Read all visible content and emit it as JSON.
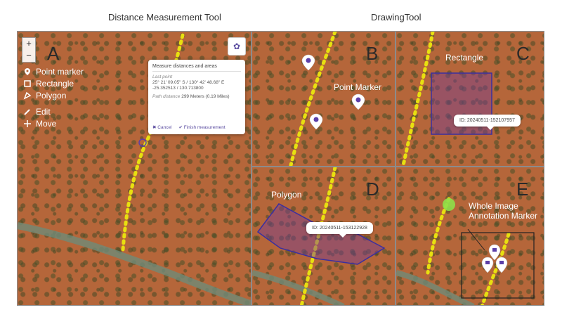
{
  "titles": {
    "left": "Distance Measurement Tool",
    "right": "DrawingTool"
  },
  "panels": {
    "a": {
      "letter": "A"
    },
    "b": {
      "letter": "B",
      "label": "Point Marker"
    },
    "c": {
      "letter": "C",
      "label": "Rectangle",
      "tooltip": "ID: 20240511-152107957"
    },
    "d": {
      "letter": "D",
      "label": "Polygon",
      "tooltip": "ID: 20240511-153122928"
    },
    "e": {
      "letter": "E",
      "label_line1": "Whole Image",
      "label_line2": "Annotation Marker"
    }
  },
  "toolbar": {
    "zoom_in": "+",
    "zoom_out": "−",
    "tools": [
      {
        "label": "Point marker",
        "icon": "pin-icon"
      },
      {
        "label": "Rectangle",
        "icon": "rectangle-icon"
      },
      {
        "label": "Polygon",
        "icon": "polygon-icon"
      },
      {
        "label": "Edit",
        "icon": "edit-icon"
      },
      {
        "label": "Move",
        "icon": "move-icon"
      }
    ]
  },
  "measure_panel": {
    "title": "Measure distances and areas",
    "last_point_label": "Last point",
    "last_point_dms": "25° 21' 09.05\" S / 130° 42' 48.68\" E",
    "last_point_dec": "-25.352513 / 130.713800",
    "path_distance_label": "Path distance",
    "path_distance_value": "299 Meters (0.19 Miles)",
    "cancel": "Cancel",
    "finish": "Finish measurement"
  },
  "colors": {
    "terrain": "#b5663a",
    "dots": "#e8e010",
    "annotation": "#5b3fa8",
    "highlight": "#8ee04a"
  }
}
